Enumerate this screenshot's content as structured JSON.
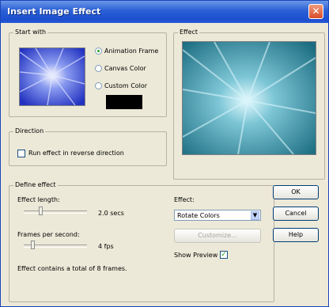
{
  "window": {
    "title": "Insert Image Effect",
    "close_icon": "close-icon"
  },
  "start_with": {
    "label": "Start with",
    "options": [
      "Animation Frame",
      "Canvas Color",
      "Custom Color"
    ],
    "selected": "Animation Frame",
    "custom_color": "#000000"
  },
  "effect_preview": {
    "label": "Effect"
  },
  "direction": {
    "label": "Direction",
    "reverse_label": "Run effect in reverse direction",
    "reverse_checked": false
  },
  "define_effect": {
    "label": "Define effect",
    "length_label": "Effect length:",
    "length_value": "2.0 secs",
    "length_fraction": 0.25,
    "fps_label": "Frames per second:",
    "fps_value": "4 fps",
    "fps_fraction": 0.12,
    "total_text": "Effect contains a total of 8 frames.",
    "effect_label": "Effect:",
    "effect_selected": "Rotate Colors",
    "customize_label": "Customize...",
    "show_preview_label": "Show Preview",
    "show_preview_checked": true
  },
  "buttons": {
    "ok": "OK",
    "cancel": "Cancel",
    "help": "Help"
  },
  "colors": {
    "accent": "#1d4fcf",
    "preview_blue": "#2a3fc8",
    "preview_teal": "#1f7f95"
  }
}
